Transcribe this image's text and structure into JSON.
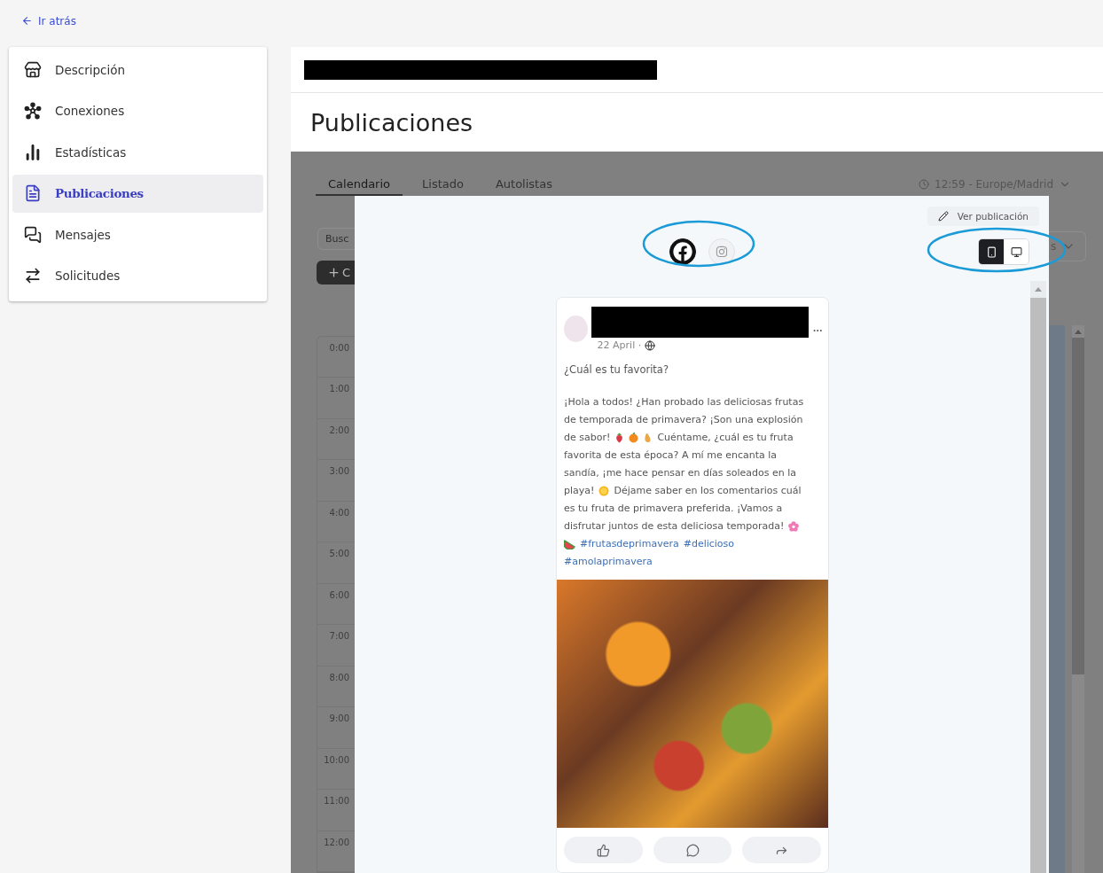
{
  "back_link": "Ir atrás",
  "sidebar": {
    "items": [
      {
        "label": "Descripción",
        "selected": false
      },
      {
        "label": "Conexiones",
        "selected": false
      },
      {
        "label": "Estadísticas",
        "selected": false
      },
      {
        "label": "Publicaciones",
        "selected": true
      },
      {
        "label": "Mensajes",
        "selected": false
      },
      {
        "label": "Solicitudes",
        "selected": false
      }
    ]
  },
  "header": {
    "title": "Publicaciones"
  },
  "background": {
    "tabs": [
      {
        "label": "Calendario",
        "selected": true
      },
      {
        "label": "Listado",
        "selected": false
      },
      {
        "label": "Autolistas",
        "selected": false
      }
    ],
    "timezone": "12:59 - Europe/Madrid",
    "search": {
      "placeholder": "Busc"
    },
    "create_button": "C",
    "select_value": "s",
    "hours": [
      "0:00",
      "1:00",
      "2:00",
      "3:00",
      "4:00",
      "5:00",
      "6:00",
      "7:00",
      "8:00",
      "9:00",
      "10:00",
      "11:00",
      "12:00"
    ]
  },
  "modal": {
    "view_button": "Ver publicación",
    "networks": [
      {
        "kind": "facebook",
        "selected": true
      },
      {
        "kind": "instagram",
        "selected": false
      }
    ],
    "devices": [
      {
        "kind": "mobile",
        "selected": true
      },
      {
        "kind": "desktop",
        "selected": false
      }
    ],
    "post": {
      "date": "22 April ·",
      "title": "¿Cuál es tu favorita?",
      "body_lines": [
        [
          {
            "kind": "text",
            "text": "¡Hola a todos! ¿Han probado las deliciosas frutas"
          }
        ],
        [
          {
            "kind": "text",
            "text": "de temporada de primavera? ¡Son una explosión"
          }
        ],
        [
          {
            "kind": "text",
            "text": "de sabor!"
          },
          {
            "kind": "strawberry"
          },
          {
            "kind": "orange"
          },
          {
            "kind": "pear"
          },
          {
            "kind": "text",
            "text": "Cuéntame, ¿cuál es tu fruta"
          }
        ],
        [
          {
            "kind": "text",
            "text": "favorita de esta época? A mí me encanta la"
          }
        ],
        [
          {
            "kind": "text",
            "text": "sandía, ¡me hace pensar en días soleados en la"
          }
        ],
        [
          {
            "kind": "text",
            "text": "playa!"
          },
          {
            "kind": "sun"
          },
          {
            "kind": "text",
            "text": "Déjame saber en los comentarios cuál"
          }
        ],
        [
          {
            "kind": "text",
            "text": "es tu fruta de primavera preferida. ¡Vamos a"
          }
        ],
        [
          {
            "kind": "text",
            "text": "disfrutar juntos de esta deliciosa temporada!"
          },
          {
            "kind": "blossom"
          }
        ],
        [
          {
            "kind": "watermelon"
          },
          {
            "kind": "hashtag",
            "text": "#frutasdeprimavera"
          },
          {
            "kind": "hashtag",
            "text": "#delicioso"
          }
        ],
        [
          {
            "kind": "hashtag",
            "text": "#amolaprimavera"
          }
        ]
      ]
    }
  }
}
